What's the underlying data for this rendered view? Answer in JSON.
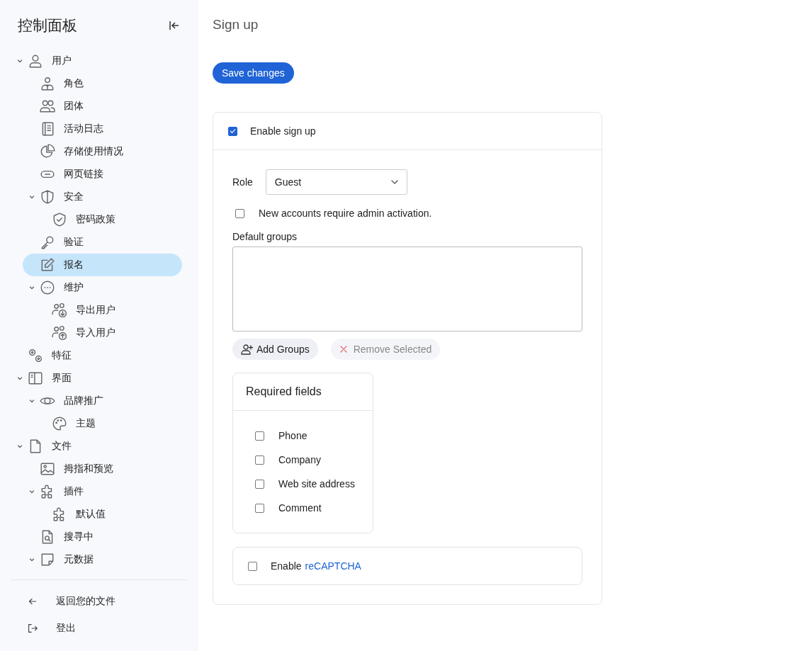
{
  "sidebar": {
    "title": "控制面板",
    "items": [
      {
        "label": "用户",
        "selected": false,
        "expanded": true,
        "children": [
          {
            "label": "角色",
            "selected": false
          },
          {
            "label": "团体",
            "selected": false
          },
          {
            "label": "活动日志",
            "selected": false
          },
          {
            "label": "存储使用情况",
            "selected": false
          },
          {
            "label": "网页链接",
            "selected": false
          },
          {
            "label": "安全",
            "selected": false,
            "expanded": true,
            "children": [
              {
                "label": "密码政策",
                "selected": false
              }
            ]
          },
          {
            "label": "验证",
            "selected": false
          },
          {
            "label": "报名",
            "selected": true
          },
          {
            "label": "维护",
            "selected": false,
            "expanded": true,
            "children": [
              {
                "label": "导出用户",
                "selected": false
              },
              {
                "label": "导入用户",
                "selected": false
              }
            ]
          }
        ]
      },
      {
        "label": "特征",
        "selected": false
      },
      {
        "label": "界面",
        "selected": false,
        "expanded": true,
        "children": [
          {
            "label": "品牌推广",
            "selected": false,
            "expanded": true,
            "children": [
              {
                "label": "主题",
                "selected": false
              }
            ]
          }
        ]
      },
      {
        "label": "文件",
        "selected": false,
        "expanded": true,
        "children": [
          {
            "label": "拇指和预览",
            "selected": false
          },
          {
            "label": "插件",
            "selected": false,
            "expanded": true,
            "children": [
              {
                "label": "默认值",
                "selected": false
              }
            ]
          },
          {
            "label": "搜寻中",
            "selected": false
          },
          {
            "label": "元数据",
            "selected": false,
            "expanded": true
          }
        ]
      }
    ],
    "footer": [
      {
        "label": "返回您的文件"
      },
      {
        "label": "登出"
      }
    ]
  },
  "page": {
    "title": "Sign up",
    "save_button": "Save changes",
    "enable_signup": {
      "label": "Enable sign up",
      "checked": true
    },
    "role": {
      "label": "Role",
      "value": "Guest"
    },
    "admin_activation": {
      "label": "New accounts require admin activation.",
      "checked": false
    },
    "default_groups": {
      "label": "Default groups"
    },
    "add_groups": "Add Groups",
    "remove_selected": {
      "label": "Remove Selected",
      "disabled": true
    },
    "required_fields": {
      "title": "Required fields",
      "fields": [
        {
          "label": "Phone",
          "checked": false
        },
        {
          "label": "Company",
          "checked": false
        },
        {
          "label": "Web site address",
          "checked": false
        },
        {
          "label": "Comment",
          "checked": false
        }
      ]
    },
    "recaptcha": {
      "prefix": "Enable",
      "link": "reCAPTCHA",
      "checked": false
    }
  }
}
